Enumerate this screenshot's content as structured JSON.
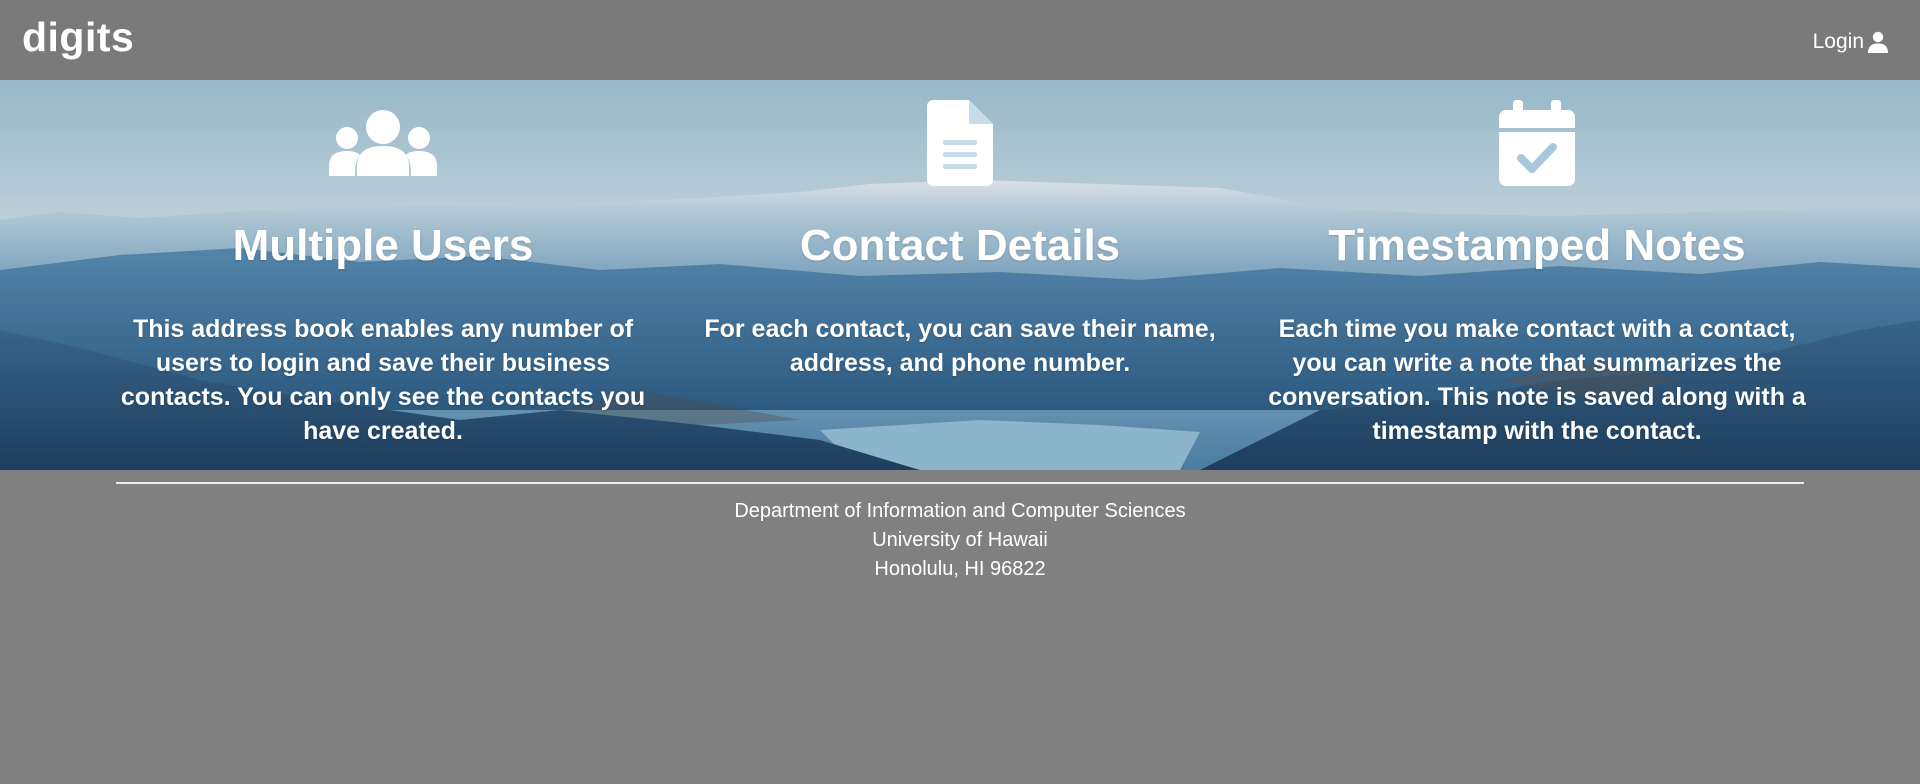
{
  "navbar": {
    "brand": "digits",
    "login_label": "Login",
    "login_icon": "user-icon"
  },
  "features": [
    {
      "icon": "users-icon",
      "title": "Multiple Users",
      "description": "This address book enables any number of users to login and save their business contacts. You can only see the contacts you have created."
    },
    {
      "icon": "file-text-icon",
      "title": "Contact Details",
      "description": "For each contact, you can save their name, address, and phone number."
    },
    {
      "icon": "calendar-check-icon",
      "title": "Timestamped Notes",
      "description": "Each time you make contact with a contact, you can write a note that summarizes the conversation. This note is saved along with a timestamp with the contact."
    }
  ],
  "footer": {
    "line1": "Department of Information and Computer Sciences",
    "line2": "University of Hawaii",
    "line3": "Honolulu, HI 96822"
  },
  "colors": {
    "navbar_bg": "#7a7a7a",
    "page_bg": "#808080",
    "text": "#ffffff"
  }
}
